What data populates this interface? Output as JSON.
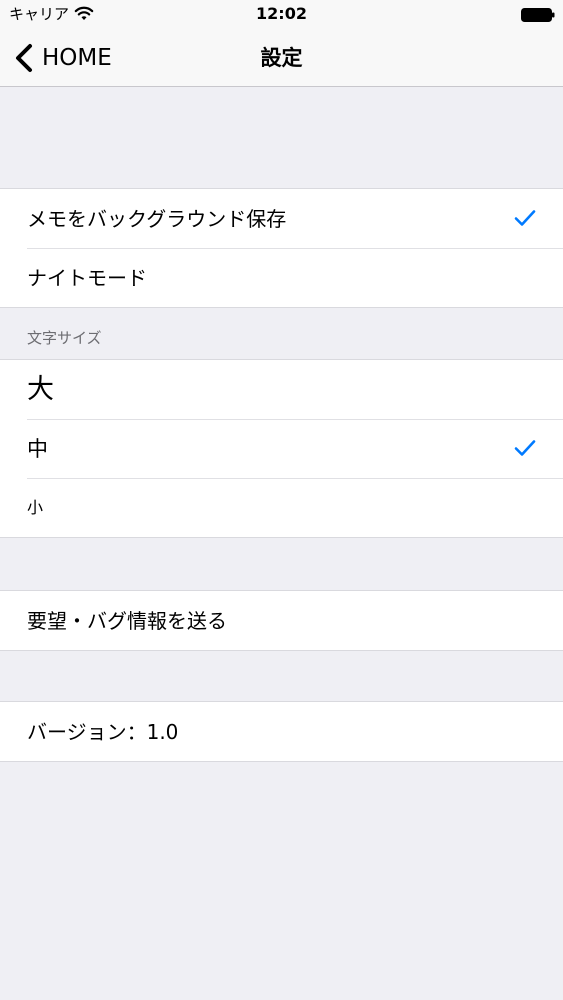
{
  "status_bar": {
    "carrier": "キャリア",
    "time": "12:02"
  },
  "nav": {
    "back_label": "HOME",
    "title": "設定"
  },
  "settings": {
    "memo_background_save": {
      "label": "メモをバックグラウンド保存",
      "checked": true
    },
    "night_mode": {
      "label": "ナイトモード",
      "checked": false
    }
  },
  "font_size_section": {
    "header": "文字サイズ",
    "options": [
      {
        "label": "大",
        "checked": false
      },
      {
        "label": "中",
        "checked": true
      },
      {
        "label": "小",
        "checked": false
      }
    ]
  },
  "feedback": {
    "label": "要望・バグ情報を送る"
  },
  "version": {
    "label": "バージョン：1.0"
  },
  "colors": {
    "accent": "#007aff",
    "background": "#efeff4",
    "section_header": "#6d6d72"
  }
}
